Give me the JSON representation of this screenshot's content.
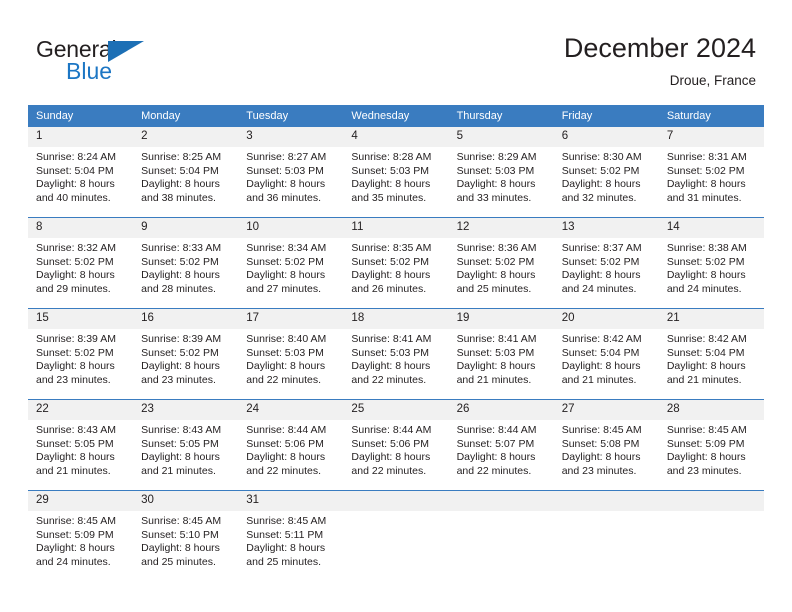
{
  "brand": {
    "name_dark": "General",
    "name_blue": "Blue",
    "triangle_icon": "blue-triangle-logo-mark",
    "colors": {
      "dark": "#231f20",
      "blue": "#1c76c4"
    }
  },
  "header": {
    "title": "December 2024",
    "subtitle": "Droue, France"
  },
  "theme": {
    "header_row_bg": "#3a7cc0",
    "daynum_bg": "#f1f1f1",
    "grid_line": "#3a7cc0",
    "text": "#231f20"
  },
  "weekday_headers": [
    "Sunday",
    "Monday",
    "Tuesday",
    "Wednesday",
    "Thursday",
    "Friday",
    "Saturday"
  ],
  "weeks": [
    [
      {
        "day": "1",
        "sunrise": "Sunrise: 8:24 AM",
        "sunset": "Sunset: 5:04 PM",
        "daylight_line1": "Daylight: 8 hours",
        "daylight_line2": "and 40 minutes."
      },
      {
        "day": "2",
        "sunrise": "Sunrise: 8:25 AM",
        "sunset": "Sunset: 5:04 PM",
        "daylight_line1": "Daylight: 8 hours",
        "daylight_line2": "and 38 minutes."
      },
      {
        "day": "3",
        "sunrise": "Sunrise: 8:27 AM",
        "sunset": "Sunset: 5:03 PM",
        "daylight_line1": "Daylight: 8 hours",
        "daylight_line2": "and 36 minutes."
      },
      {
        "day": "4",
        "sunrise": "Sunrise: 8:28 AM",
        "sunset": "Sunset: 5:03 PM",
        "daylight_line1": "Daylight: 8 hours",
        "daylight_line2": "and 35 minutes."
      },
      {
        "day": "5",
        "sunrise": "Sunrise: 8:29 AM",
        "sunset": "Sunset: 5:03 PM",
        "daylight_line1": "Daylight: 8 hours",
        "daylight_line2": "and 33 minutes."
      },
      {
        "day": "6",
        "sunrise": "Sunrise: 8:30 AM",
        "sunset": "Sunset: 5:02 PM",
        "daylight_line1": "Daylight: 8 hours",
        "daylight_line2": "and 32 minutes."
      },
      {
        "day": "7",
        "sunrise": "Sunrise: 8:31 AM",
        "sunset": "Sunset: 5:02 PM",
        "daylight_line1": "Daylight: 8 hours",
        "daylight_line2": "and 31 minutes."
      }
    ],
    [
      {
        "day": "8",
        "sunrise": "Sunrise: 8:32 AM",
        "sunset": "Sunset: 5:02 PM",
        "daylight_line1": "Daylight: 8 hours",
        "daylight_line2": "and 29 minutes."
      },
      {
        "day": "9",
        "sunrise": "Sunrise: 8:33 AM",
        "sunset": "Sunset: 5:02 PM",
        "daylight_line1": "Daylight: 8 hours",
        "daylight_line2": "and 28 minutes."
      },
      {
        "day": "10",
        "sunrise": "Sunrise: 8:34 AM",
        "sunset": "Sunset: 5:02 PM",
        "daylight_line1": "Daylight: 8 hours",
        "daylight_line2": "and 27 minutes."
      },
      {
        "day": "11",
        "sunrise": "Sunrise: 8:35 AM",
        "sunset": "Sunset: 5:02 PM",
        "daylight_line1": "Daylight: 8 hours",
        "daylight_line2": "and 26 minutes."
      },
      {
        "day": "12",
        "sunrise": "Sunrise: 8:36 AM",
        "sunset": "Sunset: 5:02 PM",
        "daylight_line1": "Daylight: 8 hours",
        "daylight_line2": "and 25 minutes."
      },
      {
        "day": "13",
        "sunrise": "Sunrise: 8:37 AM",
        "sunset": "Sunset: 5:02 PM",
        "daylight_line1": "Daylight: 8 hours",
        "daylight_line2": "and 24 minutes."
      },
      {
        "day": "14",
        "sunrise": "Sunrise: 8:38 AM",
        "sunset": "Sunset: 5:02 PM",
        "daylight_line1": "Daylight: 8 hours",
        "daylight_line2": "and 24 minutes."
      }
    ],
    [
      {
        "day": "15",
        "sunrise": "Sunrise: 8:39 AM",
        "sunset": "Sunset: 5:02 PM",
        "daylight_line1": "Daylight: 8 hours",
        "daylight_line2": "and 23 minutes."
      },
      {
        "day": "16",
        "sunrise": "Sunrise: 8:39 AM",
        "sunset": "Sunset: 5:02 PM",
        "daylight_line1": "Daylight: 8 hours",
        "daylight_line2": "and 23 minutes."
      },
      {
        "day": "17",
        "sunrise": "Sunrise: 8:40 AM",
        "sunset": "Sunset: 5:03 PM",
        "daylight_line1": "Daylight: 8 hours",
        "daylight_line2": "and 22 minutes."
      },
      {
        "day": "18",
        "sunrise": "Sunrise: 8:41 AM",
        "sunset": "Sunset: 5:03 PM",
        "daylight_line1": "Daylight: 8 hours",
        "daylight_line2": "and 22 minutes."
      },
      {
        "day": "19",
        "sunrise": "Sunrise: 8:41 AM",
        "sunset": "Sunset: 5:03 PM",
        "daylight_line1": "Daylight: 8 hours",
        "daylight_line2": "and 21 minutes."
      },
      {
        "day": "20",
        "sunrise": "Sunrise: 8:42 AM",
        "sunset": "Sunset: 5:04 PM",
        "daylight_line1": "Daylight: 8 hours",
        "daylight_line2": "and 21 minutes."
      },
      {
        "day": "21",
        "sunrise": "Sunrise: 8:42 AM",
        "sunset": "Sunset: 5:04 PM",
        "daylight_line1": "Daylight: 8 hours",
        "daylight_line2": "and 21 minutes."
      }
    ],
    [
      {
        "day": "22",
        "sunrise": "Sunrise: 8:43 AM",
        "sunset": "Sunset: 5:05 PM",
        "daylight_line1": "Daylight: 8 hours",
        "daylight_line2": "and 21 minutes."
      },
      {
        "day": "23",
        "sunrise": "Sunrise: 8:43 AM",
        "sunset": "Sunset: 5:05 PM",
        "daylight_line1": "Daylight: 8 hours",
        "daylight_line2": "and 21 minutes."
      },
      {
        "day": "24",
        "sunrise": "Sunrise: 8:44 AM",
        "sunset": "Sunset: 5:06 PM",
        "daylight_line1": "Daylight: 8 hours",
        "daylight_line2": "and 22 minutes."
      },
      {
        "day": "25",
        "sunrise": "Sunrise: 8:44 AM",
        "sunset": "Sunset: 5:06 PM",
        "daylight_line1": "Daylight: 8 hours",
        "daylight_line2": "and 22 minutes."
      },
      {
        "day": "26",
        "sunrise": "Sunrise: 8:44 AM",
        "sunset": "Sunset: 5:07 PM",
        "daylight_line1": "Daylight: 8 hours",
        "daylight_line2": "and 22 minutes."
      },
      {
        "day": "27",
        "sunrise": "Sunrise: 8:45 AM",
        "sunset": "Sunset: 5:08 PM",
        "daylight_line1": "Daylight: 8 hours",
        "daylight_line2": "and 23 minutes."
      },
      {
        "day": "28",
        "sunrise": "Sunrise: 8:45 AM",
        "sunset": "Sunset: 5:09 PM",
        "daylight_line1": "Daylight: 8 hours",
        "daylight_line2": "and 23 minutes."
      }
    ],
    [
      {
        "day": "29",
        "sunrise": "Sunrise: 8:45 AM",
        "sunset": "Sunset: 5:09 PM",
        "daylight_line1": "Daylight: 8 hours",
        "daylight_line2": "and 24 minutes."
      },
      {
        "day": "30",
        "sunrise": "Sunrise: 8:45 AM",
        "sunset": "Sunset: 5:10 PM",
        "daylight_line1": "Daylight: 8 hours",
        "daylight_line2": "and 25 minutes."
      },
      {
        "day": "31",
        "sunrise": "Sunrise: 8:45 AM",
        "sunset": "Sunset: 5:11 PM",
        "daylight_line1": "Daylight: 8 hours",
        "daylight_line2": "and 25 minutes."
      },
      {
        "day": "",
        "sunrise": "",
        "sunset": "",
        "daylight_line1": "",
        "daylight_line2": ""
      },
      {
        "day": "",
        "sunrise": "",
        "sunset": "",
        "daylight_line1": "",
        "daylight_line2": ""
      },
      {
        "day": "",
        "sunrise": "",
        "sunset": "",
        "daylight_line1": "",
        "daylight_line2": ""
      },
      {
        "day": "",
        "sunrise": "",
        "sunset": "",
        "daylight_line1": "",
        "daylight_line2": ""
      }
    ]
  ]
}
